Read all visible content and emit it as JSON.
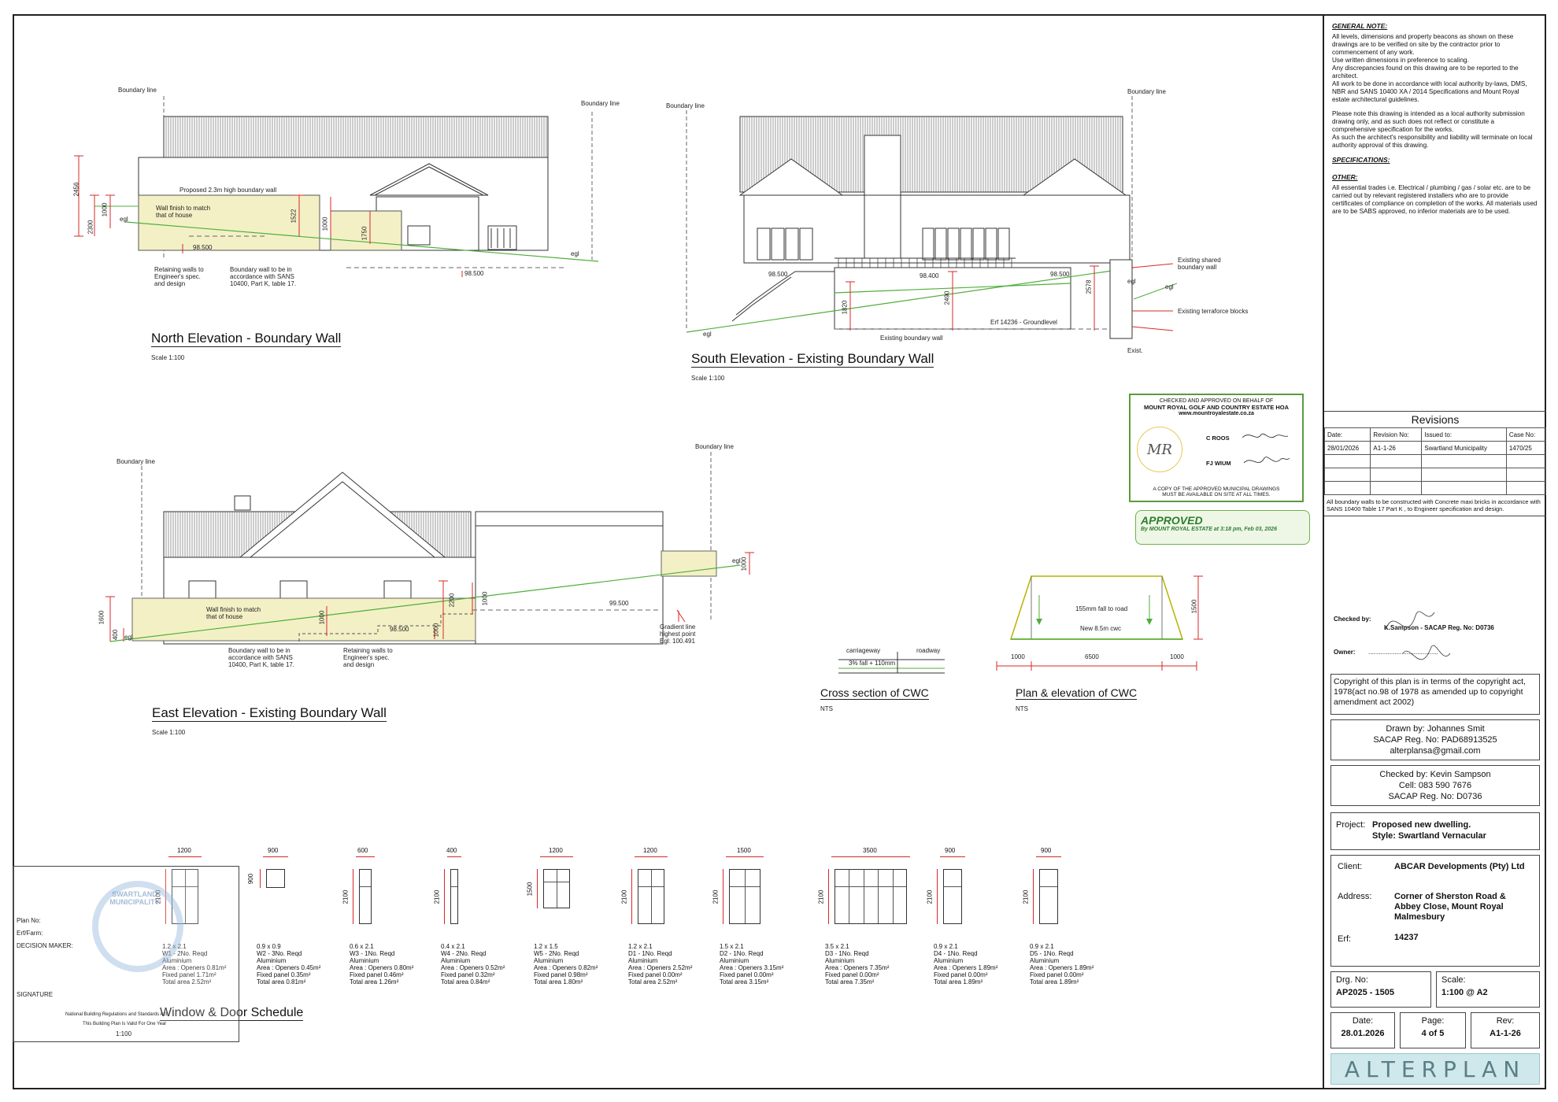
{
  "drawings": {
    "north": {
      "title": "North Elevation - Boundary Wall",
      "scale": "Scale 1:100",
      "boundary_line": "Boundary line",
      "proposed_wall": "Proposed 2.3m high boundary wall",
      "wall_finish": "Wall finish to match\nthat of house",
      "level_1": "98.500",
      "level_2": "98.500",
      "retaining": "Retaining walls to\nEngineer's spec.\nand design",
      "boundary_note": "Boundary wall to be in\naccordance with SANS\n10400, Part K, table 17.",
      "egl": "egl",
      "dims": [
        "2456",
        "2300",
        "1000",
        "1522",
        "1000",
        "1750"
      ]
    },
    "south": {
      "title": "South Elevation - Existing Boundary Wall",
      "scale": "Scale 1:100",
      "boundary_line": "Boundary line",
      "level_1": "98.500",
      "level_2": "98.400",
      "level_3": "98.500",
      "egl": "egl",
      "dims": [
        "1820",
        "2490",
        "2578"
      ],
      "existing_shared": "Existing shared\nboundary wall",
      "terraforce": "Existing terraforce blocks",
      "erf": "Erf 14236 - Groundlevel",
      "existing_boundary": "Existing boundary wall",
      "exist": "Exist."
    },
    "east": {
      "title": "East Elevation - Existing Boundary Wall",
      "scale": "Scale 1:100",
      "boundary_line": "Boundary line",
      "wall_finish": "Wall finish to match\nthat of house",
      "boundary_note": "Boundary wall to be in\naccordance with SANS\n10400, Part K, table 17.",
      "retaining": "Retaining walls to\nEngineer's spec.\nand design",
      "level_1": "98.500",
      "level_2": "99.500",
      "gradient": "Gradient line\nhighest point\nEgl: 100.491",
      "egl": "egl",
      "dims": [
        "1600",
        "400",
        "1000",
        "2200",
        "1000",
        "1000",
        "1000"
      ]
    },
    "cwc_section": {
      "title": "Cross section of CWC",
      "scale": "NTS",
      "carriageway": "carriageway",
      "roadway": "roadway",
      "fall": "3% fall + 110mm"
    },
    "cwc_plan": {
      "title": "Plan & elevation of CWC",
      "scale": "NTS",
      "fall_note": "155mm fall to road",
      "new_cwc": "New 8.5m cwc",
      "dims": [
        "1000",
        "6500",
        "1000",
        "1500"
      ]
    }
  },
  "schedule": {
    "title": "Window & Door Schedule",
    "items": [
      {
        "width": "1200",
        "height": "2100",
        "size": "1.2 x 2.1",
        "code": "W1 - 2No. Reqd",
        "material": "Aluminium",
        "openers": "Area : Openers 0.81m²",
        "fixed": "Fixed panel 1.71m²",
        "total": "Total area 2.52m²"
      },
      {
        "width": "900",
        "height": "900",
        "size": "0.9 x 0.9",
        "code": "W2 - 3No. Reqd",
        "material": "Aluminium",
        "openers": "Area : Openers 0.45m²",
        "fixed": "Fixed panel 0.35m²",
        "total": "Total area 0.81m²"
      },
      {
        "width": "600",
        "height": "2100",
        "size": "0.6 x 2.1",
        "code": "W3 - 1No. Reqd",
        "material": "Aluminium",
        "openers": "Area : Openers 0.80m²",
        "fixed": "Fixed panel 0.46m²",
        "total": "Total area 1.26m²"
      },
      {
        "width": "400",
        "height": "2100",
        "size": "0.4 x 2.1",
        "code": "W4 - 2No. Reqd",
        "material": "Aluminium",
        "openers": "Area : Openers 0.52m²",
        "fixed": "Fixed panel 0.32m²",
        "total": "Total area 0.84m²"
      },
      {
        "width": "1200",
        "height": "1500",
        "size": "1.2 x 1.5",
        "code": "W5 - 2No. Reqd",
        "material": "Aluminium",
        "openers": "Area : Openers 0.82m²",
        "fixed": "Fixed panel 0.98m²",
        "total": "Total area 1.80m²"
      },
      {
        "width": "1200",
        "height": "2100",
        "size": "1.2 x 2.1",
        "code": "D1 - 1No. Reqd",
        "material": "Aluminium",
        "openers": "Area : Openers 2.52m²",
        "fixed": "Fixed panel 0.00m²",
        "total": "Total area 2.52m²"
      },
      {
        "width": "1500",
        "height": "2100",
        "size": "1.5 x 2.1",
        "code": "D2 - 1No. Reqd",
        "material": "Aluminium",
        "openers": "Area : Openers 3.15m²",
        "fixed": "Fixed panel 0.00m²",
        "total": "Total area 3.15m²"
      },
      {
        "width": "3500",
        "height": "2100",
        "size": "3.5 x 2.1",
        "code": "D3 - 1No. Reqd",
        "material": "Aluminium",
        "openers": "Area : Openers 7.35m²",
        "fixed": "Fixed panel 0.00m²",
        "total": "Total area 7.35m²"
      },
      {
        "width": "900",
        "height": "2100",
        "size": "0.9 x 2.1",
        "code": "D4 - 1No. Reqd",
        "material": "Aluminium",
        "openers": "Area : Openers 1.89m²",
        "fixed": "Fixed panel 0.00m²",
        "total": "Total area 1.89m²"
      },
      {
        "width": "900",
        "height": "2100",
        "size": "0.9 x 2.1",
        "code": "D5 - 1No. Reqd",
        "material": "Aluminium",
        "openers": "Area : Openers 1.89m²",
        "fixed": "Fixed panel 0.00m²",
        "total": "Total area 1.89m²"
      }
    ]
  },
  "municipal_stamp": {
    "plan_no": "Plan No:",
    "erf_farm": "Erf/Farm:",
    "decision_maker": "DECISION MAKER:",
    "signature": "SIGNATURE",
    "footer1": "National Building Regulations and Standards Act",
    "footer2": "This Building Plan Is Valid For One Year",
    "scale": "1:100",
    "seal": "SWARTLAND MUNICIPALITY"
  },
  "hoa_stamp": {
    "line1": "CHECKED AND APPROVED ON BEHALF OF",
    "line2": "MOUNT ROYAL GOLF AND COUNTRY ESTATE HOA",
    "site": "www.mountroyalestate.co.za",
    "name1": "C ROOS",
    "name2": "FJ WIUM",
    "logo": "MR",
    "footer": "A COPY OF THE APPROVED MUNICIPAL DRAWINGS\nMUST BE AVAILABLE ON SITE AT ALL TIMES."
  },
  "approved_stamp": {
    "title": "APPROVED",
    "by": "By MOUNT ROYAL ESTATE at 3:18 pm, Feb 03, 2026"
  },
  "titleblock": {
    "general_note_title": "GENERAL NOTE:",
    "general_note_1": "All levels, dimensions and property beacons as shown on these drawings are to be verified on site by the contractor prior to commencement of any work.\nUse written dimensions in preference to scaling.\nAny discrepancies found on this drawing are to be reported to the architect.\nAll work to be done in accordance with local authority by-laws, DMS, NBR and SANS 10400 XA / 2014 Specifications and Mount Royal estate architectural guidelines.",
    "general_note_2": "Please note this drawing is intended as a local authority submission drawing only, and as such does not reflect or constitute a comprehensive specification for the works.\nAs such the architect's responsibility and liability will terminate on local authority approval of this drawing.",
    "specs_title": "SPECIFICATIONS:",
    "other_title": "OTHER:",
    "other_text": "All essential trades i.e. Electrical / plumbing / gas / solar etc. are to be carried out by relevant registered installers who are to provide certificates of compliance on completion of the works. All materials used are to be SABS approved, no inferior materials are to be used.",
    "revisions_title": "Revisions",
    "rev_headers": [
      "Date:",
      "Revision No:",
      "Issued to:",
      "Case No:"
    ],
    "rev_row": [
      "28/01/2026",
      "A1-1-26",
      "Swartland Municipality",
      "1470/25"
    ],
    "boundary_note": "All boundary walls to be constructed with Concrete maxi bricks in accordance with SANS 10400 Table 17 Part K , to Engineer specification and design.",
    "checked_by_label": "Checked by:",
    "checked_by_value": "K.Sampson - SACAP Reg. No: D0736",
    "owner_label": "Owner:",
    "owner_value": "........................................",
    "copyright": "Copyright of this plan is in terms of the copyright act, 1978(act no.98 of 1978 as amended up to copyright amendment act 2002)",
    "drawn_by": "Drawn by: Johannes Smit",
    "drawn_reg": "SACAP Reg. No: PAD68913525",
    "drawn_email": "alterplansa@gmail.com",
    "checked_name": "Checked by: Kevin Sampson",
    "checked_cell": "Cell: 083 590 7676",
    "checked_reg": "SACAP Reg. No: D0736",
    "project_label": "Project:",
    "project_value": "Proposed new dwelling.\nStyle: Swartland Vernacular",
    "client_label": "Client:",
    "client_value": "ABCAR Developments (Pty) Ltd",
    "address_label": "Address:",
    "address_value": "Corner of Sherston Road & Abbey Close, Mount Royal Malmesbury",
    "erf_label": "Erf:",
    "erf_value": "14237",
    "drg_label": "Drg. No:",
    "drg_value": "AP2025 - 1505",
    "scale_label": "Scale:",
    "scale_value": "1:100 @ A2",
    "date_label": "Date:",
    "date_value": "28.01.2026",
    "page_label": "Page:",
    "page_value": "4 of 5",
    "rev_label": "Rev:",
    "rev_value": "A1-1-26",
    "logo": "ALTERPLAN"
  },
  "colors": {
    "wall_fill": "#f3f0c6",
    "dim_red": "#d8282a",
    "grade_green": "#4fae3a",
    "stamp_green": "#5a9b3c",
    "logo_bg": "#cfe8ec"
  }
}
